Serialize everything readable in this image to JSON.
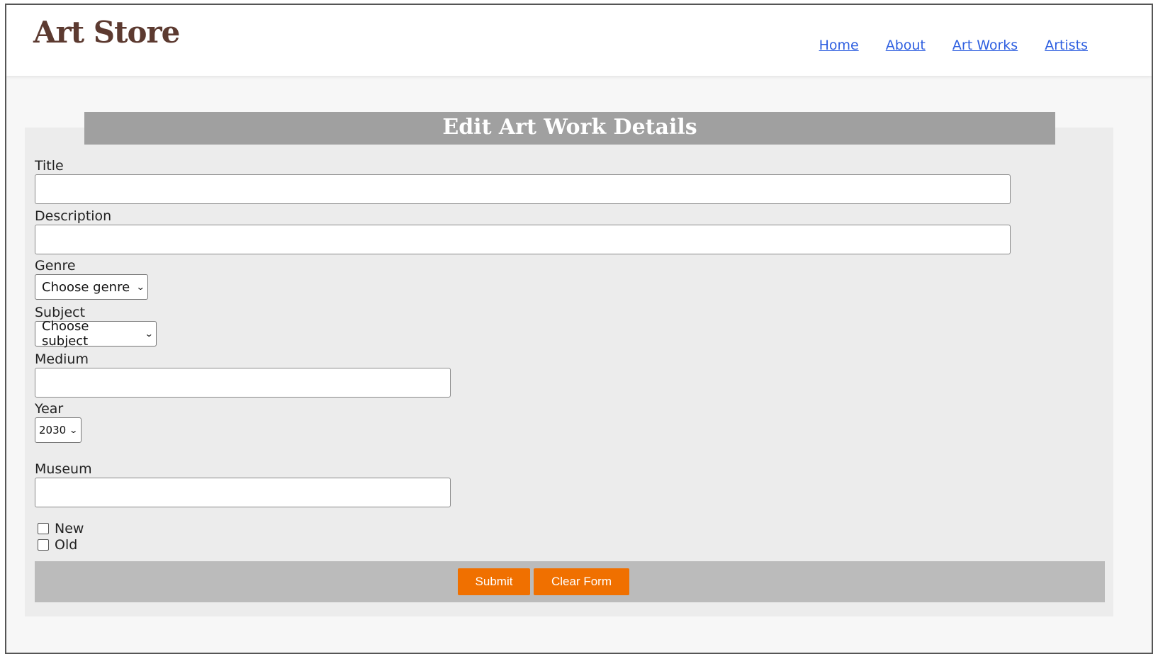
{
  "brand": "Art Store",
  "nav": {
    "items": [
      "Home",
      "About",
      "Art Works",
      "Artists"
    ]
  },
  "form": {
    "heading": "Edit Art Work Details",
    "title_label": "Title",
    "title_value": "",
    "description_label": "Description",
    "description_value": "",
    "genre_label": "Genre",
    "genre_selected": "Choose genre",
    "subject_label": "Subject",
    "subject_selected": "Choose subject",
    "medium_label": "Medium",
    "medium_value": "",
    "year_label": "Year",
    "year_selected": "2030",
    "museum_label": "Museum",
    "museum_value": "",
    "checkboxes": [
      {
        "label": "New",
        "checked": false
      },
      {
        "label": "Old",
        "checked": false
      }
    ],
    "submit_label": "Submit",
    "clear_label": "Clear Form"
  },
  "colors": {
    "brand": "#5c3a30",
    "link": "#2e5fe0",
    "heading_bar": "#a0a0a0",
    "button": "#f07000",
    "button_bar": "#bbbbbb"
  }
}
